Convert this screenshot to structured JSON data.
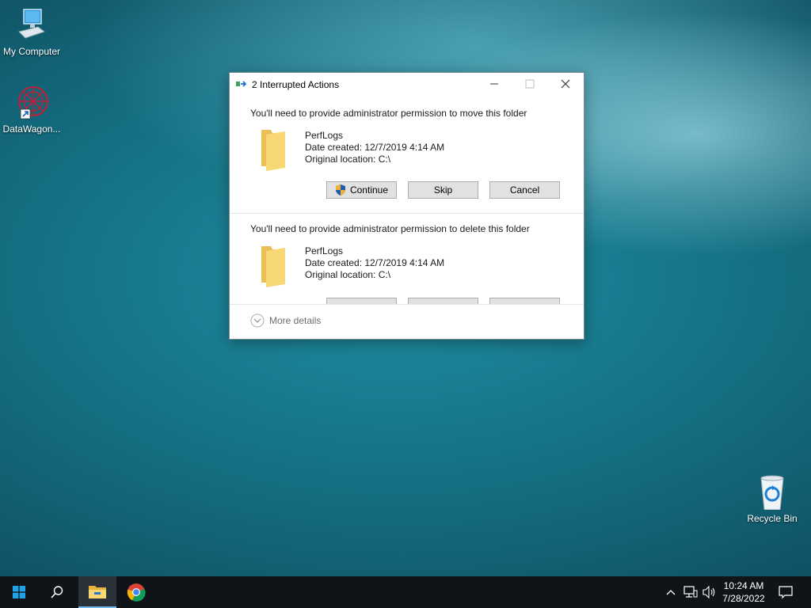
{
  "desktop": {
    "icons": [
      {
        "label": "My Computer"
      },
      {
        "label": "DataWagon..."
      },
      {
        "label": "Recycle Bin"
      }
    ]
  },
  "dialog": {
    "title": "2 Interrupted Actions",
    "sections": [
      {
        "message": "You'll need to provide administrator permission to move this folder",
        "name": "PerfLogs",
        "date_created": "Date created: 12/7/2019 4:14 AM",
        "location": "Original location: C:\\",
        "continue_label": "Continue",
        "skip_label": "Skip",
        "cancel_label": "Cancel"
      },
      {
        "message": "You'll need to provide administrator permission to delete this folder",
        "name": "PerfLogs",
        "date_created": "Date created: 12/7/2019 4:14 AM",
        "location": "Original location: C:\\"
      }
    ],
    "more_details": "More details"
  },
  "taskbar": {
    "time": "10:24 AM",
    "date": "7/28/2022"
  },
  "colors": {
    "accent": "#0078d7",
    "folder": "#f5d37a",
    "taskbar": "#101418"
  }
}
